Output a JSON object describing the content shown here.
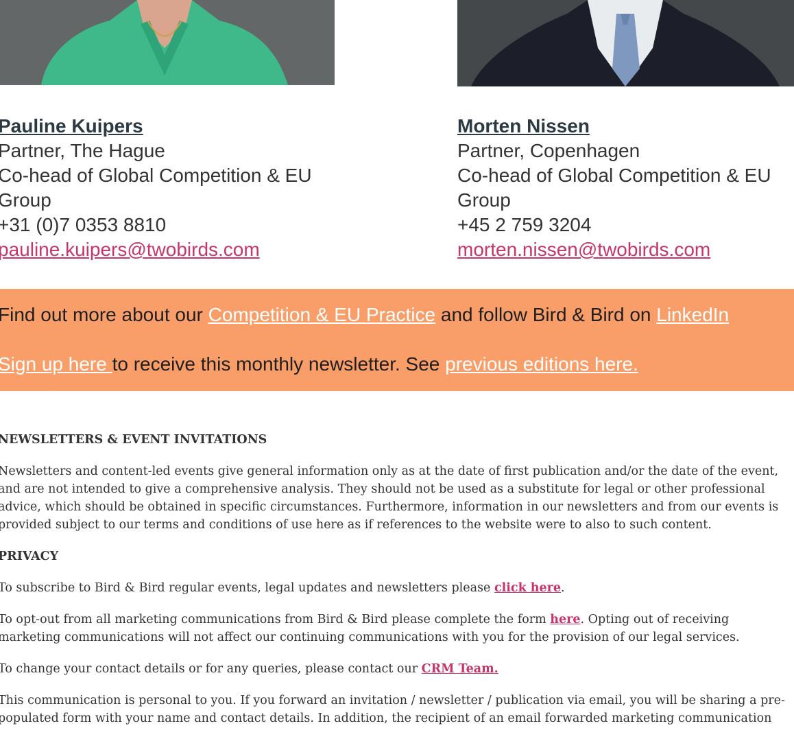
{
  "contacts": [
    {
      "name": "Pauline Kuipers",
      "role": "Partner, The Hague",
      "title_line1": "Co-head of Global Competition & EU",
      "title_line2": "Group",
      "phone": "+31 (0)7 0353 8810",
      "email": "pauline.kuipers@twobirds.com"
    },
    {
      "name": "Morten Nissen",
      "role": "Partner, Copenhagen",
      "title_line1": "Co-head of Global Competition & EU",
      "title_line2": "Group",
      "phone": "+45 2 759 3204",
      "email": "morten.nissen@twobirds.com"
    }
  ],
  "banner": {
    "line1_pre": "Find out more about our ",
    "practice_link": "Competition & EU Practice",
    "line1_mid": " and follow Bird & Bird on ",
    "linkedin_link": "LinkedIn",
    "signup_link": "Sign up here ",
    "line2_mid": "to receive this monthly newsletter.  See ",
    "previous_link": "previous editions here."
  },
  "legal": {
    "newsletters_heading": "NEWSLETTERS & EVENT INVITATIONS",
    "newsletters_text": "Newsletters and content-led events give general information only as at the date of first publication and/or the date of the event, and are not intended to give a comprehensive analysis. They should not be used as a substitute for legal or other professional advice, which should be obtained in specific circumstances. Furthermore, information in our newsletters and from our events is provided subject to our terms and conditions of use here as if references to the website were to also to such content.",
    "privacy_heading": "PRIVACY",
    "subscribe_pre": "To subscribe to Bird & Bird regular events, legal updates and newsletters please ",
    "subscribe_link": "click here",
    "subscribe_post": ".",
    "optout_pre": "To opt-out from all marketing communications from Bird & Bird please complete the form ",
    "optout_link": "here",
    "optout_post": ". Opting out of receiving marketing communications will not affect our continuing communications with you for the provision of our legal services.",
    "contact_pre": "To change your contact details or for any queries, please contact our ",
    "contact_link": "CRM Team.",
    "personal_text": "This communication is personal to you. If you forward an invitation / newsletter / publication via email, you will be sharing a pre-populated form with your name and contact details.  In addition, the recipient of an email forwarded marketing communication"
  }
}
